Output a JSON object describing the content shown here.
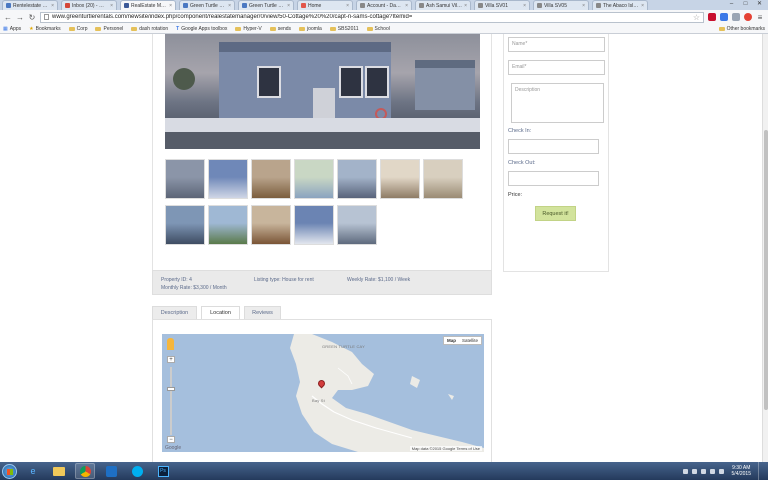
{
  "browser": {
    "tabs": [
      {
        "label": "Rentelestate (UI.A",
        "favicon_color": "#4a78c2",
        "active": false
      },
      {
        "label": "Inbox (20) - mbox",
        "favicon_color": "#d44638",
        "active": false
      },
      {
        "label": "RealEstate Manag",
        "favicon_color": "#3b5998",
        "active": true
      },
      {
        "label": "Green Turtle Renta",
        "favicon_color": "#4a78c2",
        "active": false
      },
      {
        "label": "Green Turtle Renta",
        "favicon_color": "#4a78c2",
        "active": false
      },
      {
        "label": "Home",
        "favicon_color": "#e2574c",
        "active": false
      },
      {
        "label": "Account - Dashbo",
        "favicon_color": "#888888",
        "active": false
      },
      {
        "label": "Ash Samui Villas",
        "favicon_color": "#888888",
        "active": false
      },
      {
        "label": "Villa SV01",
        "favicon_color": "#888888",
        "active": false
      },
      {
        "label": "Villa SV05",
        "favicon_color": "#888888",
        "active": false
      },
      {
        "label": "The Abaco Island",
        "favicon_color": "#888888",
        "active": false
      }
    ],
    "window_buttons": {
      "minimize": "–",
      "maximize": "□",
      "close": "✕"
    },
    "url": "www.greenturtlerentals.com/newsite/index.php/component/realestatemanager/0/view/50-Cottage%20%20/capt-n-sams-cottage?Itemid=",
    "bookmarks": [
      {
        "label": "Apps",
        "kind": "apps"
      },
      {
        "label": "Bookmarks",
        "kind": "star"
      },
      {
        "label": "Corp",
        "kind": "folder"
      },
      {
        "label": "Personel",
        "kind": "folder"
      },
      {
        "label": "dash rotation",
        "kind": "folder"
      },
      {
        "label": "Google Apps toolbox",
        "kind": "link"
      },
      {
        "label": "Hyper-V",
        "kind": "folder"
      },
      {
        "label": "sends",
        "kind": "folder"
      },
      {
        "label": "joomla",
        "kind": "folder"
      },
      {
        "label": "SBS2011",
        "kind": "folder"
      },
      {
        "label": "School",
        "kind": "folder"
      }
    ],
    "other_bookmarks": "Other bookmarks"
  },
  "property": {
    "info": {
      "property_id": "Property ID: 4",
      "listing_type": "Listing type: House for rent",
      "weekly_rate": "Weekly Rate: $1,100 / Week",
      "monthly_rate": "Monthly Rate: $3,300 / Month"
    },
    "tabs": [
      {
        "label": "Description",
        "active": false
      },
      {
        "label": "Location",
        "active": true
      },
      {
        "label": "Reviews",
        "active": false
      }
    ],
    "thumbnail_count": 12
  },
  "map": {
    "type_buttons": [
      "Map",
      "Satellite"
    ],
    "zoom_in": "+",
    "zoom_out": "−",
    "place_label": "GREEN TURTLE CAY",
    "road_label": "Bay St",
    "google_logo": "Google",
    "credits": "Map data ©2015 Google   Terms of Use"
  },
  "form": {
    "name_placeholder": "Name*",
    "email_placeholder": "Email*",
    "description_placeholder": "Description",
    "checkin_label": "Check In:",
    "checkout_label": "Check Out:",
    "price_label": "Price:",
    "request_button": "Request it!"
  },
  "taskbar": {
    "time": "9:30 AM",
    "date": "5/4/2015"
  }
}
